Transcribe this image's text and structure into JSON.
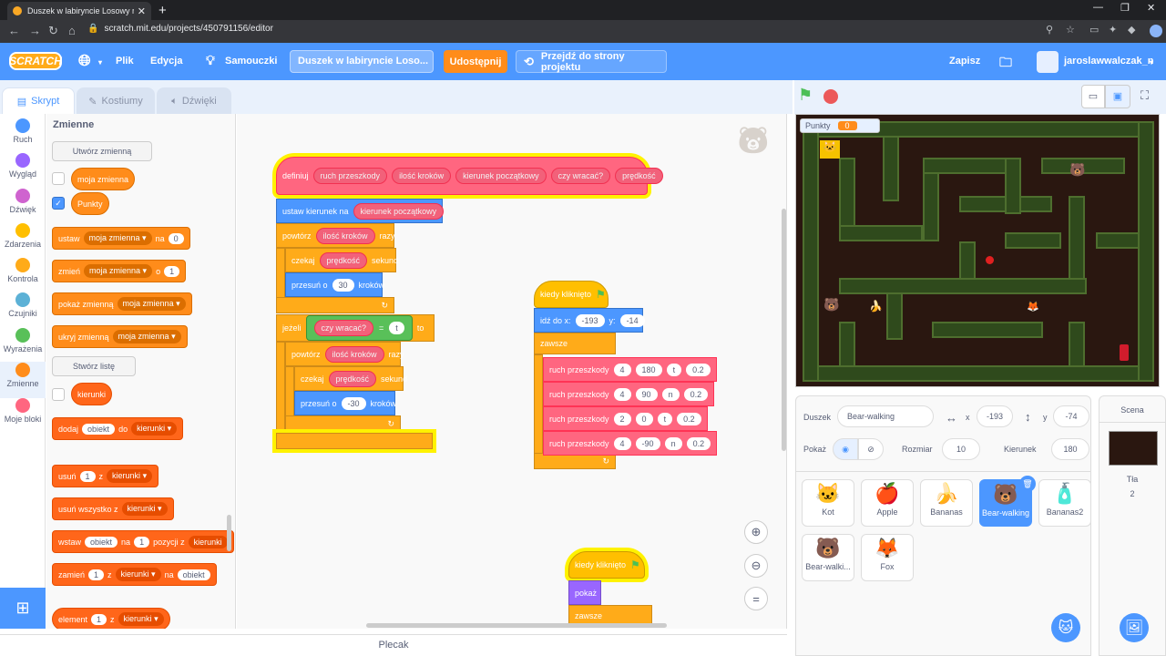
{
  "browser": {
    "tab_title": "Duszek w labiryncie Losowy ruch",
    "url": "scratch.mit.edu/projects/450791156/editor"
  },
  "menubar": {
    "logo": "SCRATCH",
    "file": "Plik",
    "edit": "Edycja",
    "tutorials": "Samouczki",
    "project_title": "Duszek w labiryncie Loso...",
    "share": "Udostępnij",
    "see_project_page": "Przejdź do strony projektu",
    "save": "Zapisz",
    "username": "jaroslawwalczak_n"
  },
  "editor_tabs": {
    "code": "Skrypt",
    "costumes": "Kostiumy",
    "sounds": "Dźwięki"
  },
  "categories": [
    {
      "label": "Ruch",
      "color": "#4c97ff"
    },
    {
      "label": "Wygląd",
      "color": "#9966ff"
    },
    {
      "label": "Dźwięk",
      "color": "#cf63cf"
    },
    {
      "label": "Zdarzenia",
      "color": "#ffbf00"
    },
    {
      "label": "Kontrola",
      "color": "#ffab19"
    },
    {
      "label": "Czujniki",
      "color": "#5cb1d6"
    },
    {
      "label": "Wyrażenia",
      "color": "#59c059"
    },
    {
      "label": "Zmienne",
      "color": "#ff8c1a"
    },
    {
      "label": "Moje bloki",
      "color": "#ff6680"
    }
  ],
  "palette": {
    "header": "Zmienne",
    "make_variable": "Utwórz zmienną",
    "var1": "moja zmienna",
    "var2": "Punkty",
    "set_block": {
      "a": "ustaw",
      "dd": "moja zmienna",
      "b": "na",
      "v": "0"
    },
    "change_block": {
      "a": "zmień",
      "dd": "moja zmienna",
      "b": "o",
      "v": "1"
    },
    "show_block": {
      "a": "pokaż zmienną",
      "dd": "moja zmienna"
    },
    "hide_block": {
      "a": "ukryj zmienną",
      "dd": "moja zmienna"
    },
    "make_list": "Stwórz listę",
    "list1": "kierunki",
    "add_block": {
      "a": "dodaj",
      "v": "obiekt",
      "b": "do",
      "dd": "kierunki"
    },
    "delete_block": {
      "a": "usuń",
      "v": "1",
      "b": "z",
      "dd": "kierunki"
    },
    "delete_all_block": {
      "a": "usuń wszystko z",
      "dd": "kierunki"
    },
    "insert_block": {
      "a": "wstaw",
      "v": "obiekt",
      "b": "na",
      "v2": "1",
      "c": "pozycji z",
      "dd": "kierunki"
    },
    "replace_block": {
      "a": "zamień",
      "v": "1",
      "b": "z",
      "dd": "kierunki",
      "c": "na",
      "v2": "obiekt"
    },
    "item_block": {
      "a": "element",
      "v": "1",
      "b": "z",
      "dd": "kierunki"
    }
  },
  "script1": {
    "define": "definiuj",
    "name": "ruch przeszkody",
    "params": [
      "ilość kroków",
      "kierunek początkowy",
      "czy wracać?",
      "prędkość"
    ],
    "point": "ustaw kierunek na",
    "point_arg": "kierunek początkowy",
    "repeat": "powtórz",
    "repeat_arg": "ilość kroków",
    "times": "razy",
    "wait": "czekaj",
    "wait_arg": "prędkość",
    "seconds": "sekund",
    "move": "przesuń o",
    "move_val": "30",
    "steps": "kroków",
    "if": "jeżeli",
    "if_arg": "czy wracać?",
    "eq": "=",
    "eq_val": "t",
    "then": "to",
    "repeat2": "powtórz",
    "repeat2_arg": "ilość kroków",
    "times2": "razy",
    "wait2": "czekaj",
    "wait2_arg": "prędkość",
    "seconds2": "sekund",
    "move2": "przesuń o",
    "move2_val": "-30",
    "steps2": "kroków"
  },
  "script2": {
    "hat": "kiedy kliknięto",
    "goto": "idź do x:",
    "x": "-193",
    "y_label": "y:",
    "y": "-14",
    "forever": "zawsze",
    "calls": [
      {
        "name": "ruch przeszkody",
        "a": "4",
        "b": "180",
        "c": "t",
        "d": "0.2"
      },
      {
        "name": "ruch przeszkody",
        "a": "4",
        "b": "90",
        "c": "n",
        "d": "0.2"
      },
      {
        "name": "ruch przeszkody",
        "a": "2",
        "b": "0",
        "c": "t",
        "d": "0.2"
      },
      {
        "name": "ruch przeszkody",
        "a": "4",
        "b": "-90",
        "c": "n",
        "d": "0.2"
      }
    ]
  },
  "script3": {
    "hat": "kiedy kliknięto",
    "show": "pokaż",
    "forever": "zawsze"
  },
  "backpack": "Plecak",
  "stage": {
    "monitor_label": "Punkty",
    "monitor_value": "0"
  },
  "sprite_info": {
    "sprite_label": "Duszek",
    "sprite_name": "Bear-walking",
    "x_label": "x",
    "x": "-193",
    "y_label": "y",
    "y": "-74",
    "show_label": "Pokaż",
    "size_label": "Rozmiar",
    "size": "10",
    "direction_label": "Kierunek",
    "direction": "180"
  },
  "sprites": [
    {
      "name": "Kot",
      "icon": "🐱"
    },
    {
      "name": "Apple",
      "icon": "🍎"
    },
    {
      "name": "Bananas",
      "icon": "🍌"
    },
    {
      "name": "Bear-walking",
      "icon": "🐻"
    },
    {
      "name": "Bananas2",
      "icon": "🧴"
    },
    {
      "name": "Bear-walki...",
      "icon": "🐻"
    },
    {
      "name": "Fox",
      "icon": "🦊"
    }
  ],
  "stage_panel": {
    "title": "Scena",
    "backdrops_label": "Tła",
    "backdrops_count": "2"
  }
}
